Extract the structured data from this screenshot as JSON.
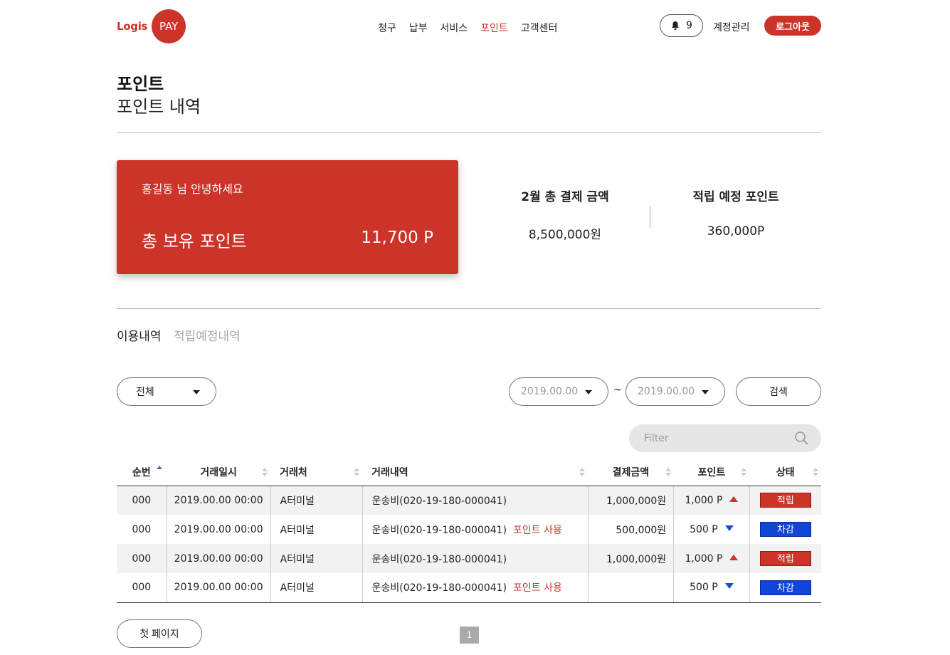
{
  "header": {
    "logo_text": "Logis",
    "logo_badge": "PAY",
    "nav": [
      {
        "label": "청구",
        "active": false
      },
      {
        "label": "납부",
        "active": false
      },
      {
        "label": "서비스",
        "active": false
      },
      {
        "label": "포인트",
        "active": true
      },
      {
        "label": "고객센터",
        "active": false
      }
    ],
    "notification_count": "9",
    "account_label": "계정관리",
    "logout_label": "로그아웃"
  },
  "page": {
    "title": "포인트",
    "subtitle": "포인트 내역"
  },
  "points_card": {
    "greeting": "홍길동 님 안녕하세요",
    "total_label": "총 보유 포인트",
    "total_value": "11,700 P"
  },
  "stats": {
    "payment_label": "2월 총 결제 금액",
    "payment_value": "8,500,000원",
    "expected_label": "적립 예정 포인트",
    "expected_value": "360,000P"
  },
  "tabs": {
    "usage": "이용내역",
    "expected": "적립예정내역"
  },
  "filters": {
    "type_value": "전체",
    "date_from": "2019.00.00",
    "date_separator": "~",
    "date_to": "2019.00.00",
    "search_label": "검색",
    "filter_placeholder": "Filter"
  },
  "table": {
    "columns": [
      "순번",
      "거래일시",
      "거래처",
      "거래내역",
      "결제금액",
      "포인트",
      "상태"
    ],
    "rows": [
      {
        "num": "000",
        "datetime": "2019.00.00 00:00",
        "partner": "A터미널",
        "detail": "운송비(020-19-180-000041)",
        "tag": "",
        "amount": "1,000,000원",
        "points": "1,000 P",
        "direction": "up",
        "status": "적립"
      },
      {
        "num": "000",
        "datetime": "2019.00.00 00:00",
        "partner": "A터미널",
        "detail": "운송비(020-19-180-000041)",
        "tag": "포인트 사용",
        "amount": "500,000원",
        "points": "500 P",
        "direction": "down",
        "status": "차감"
      },
      {
        "num": "000",
        "datetime": "2019.00.00 00:00",
        "partner": "A터미널",
        "detail": "운송비(020-19-180-000041)",
        "tag": "",
        "amount": "1,000,000원",
        "points": "1,000 P",
        "direction": "up",
        "status": "적립"
      },
      {
        "num": "000",
        "datetime": "2019.00.00 00:00",
        "partner": "A터미널",
        "detail": "운송비(020-19-180-000041)",
        "tag": "포인트 사용",
        "amount": "",
        "points": "500 P",
        "direction": "down",
        "status": "차감"
      }
    ]
  },
  "pagination": {
    "first_label": "첫 페이지",
    "current_page": "1"
  },
  "colors": {
    "brand": "#cc3329",
    "deduct": "#1045d8"
  }
}
